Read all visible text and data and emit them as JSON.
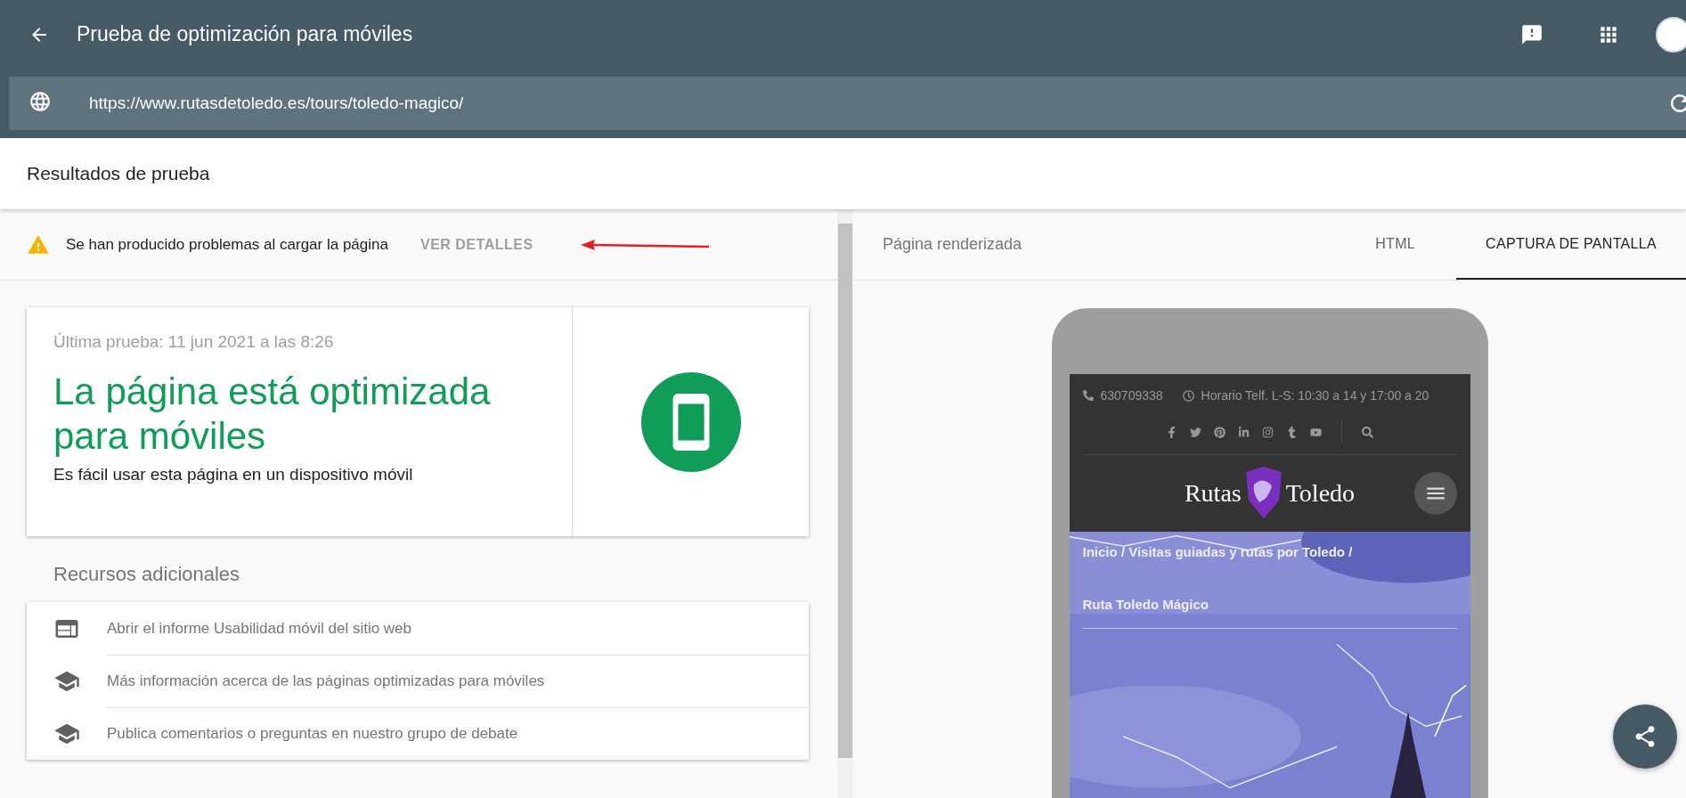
{
  "app_bar": {
    "title": "Prueba de optimización para móviles"
  },
  "url_bar": {
    "value": "https://www.rutasdetoledo.es/tours/toledo-magico/"
  },
  "results_header": {
    "title": "Resultados de prueba"
  },
  "warning": {
    "message": "Se han producido problemas al cargar la página",
    "action": "VER DETALLES"
  },
  "result_card": {
    "last_test": "Última prueba: 11 jun 2021 a las 8:26",
    "verdict": "La página está optimizada para móviles",
    "description": "Es fácil usar esta página en un dispositivo móvil"
  },
  "resources": {
    "title": "Recursos adicionales",
    "items": [
      {
        "kind": "report",
        "label": "Abrir el informe Usabilidad móvil del sitio web"
      },
      {
        "kind": "learn",
        "label": "Más información acerca de las páginas optimizadas para móviles"
      },
      {
        "kind": "learn",
        "label": "Publica comentarios o preguntas en nuestro grupo de debate"
      }
    ]
  },
  "right_panel": {
    "title": "Página renderizada",
    "tabs": [
      {
        "label": "HTML",
        "selected": false
      },
      {
        "label": "CAPTURA DE PANTALLA",
        "selected": true
      }
    ]
  },
  "rendered_page": {
    "phone": "630709338",
    "hours": "Horario Telf. L-S: 10:30 a 14 y 17:00 a 20",
    "logo_left": "Rutas",
    "logo_right": "Toledo",
    "breadcrumb": "Inicio / Visitas guiadas y rutas por Toledo /",
    "page_title": "Ruta Toledo Mágico"
  }
}
